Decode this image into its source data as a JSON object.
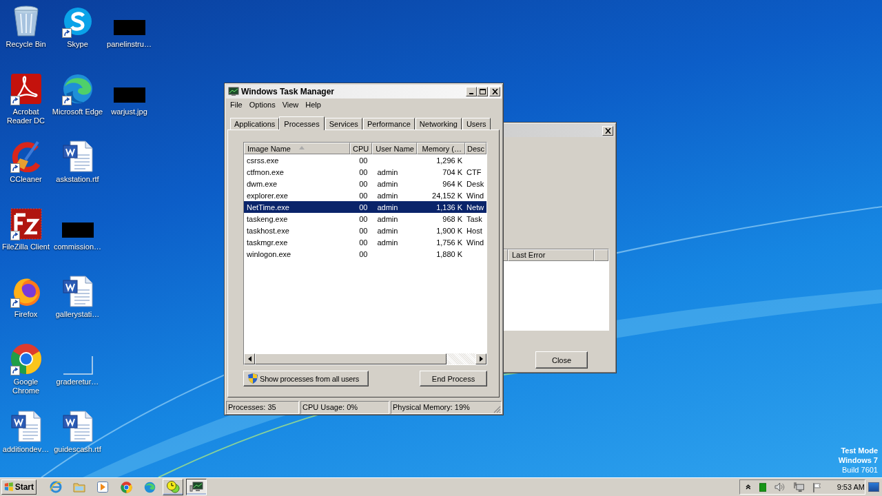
{
  "desktop_rows": [
    [
      {
        "label": "Recycle Bin",
        "kind": "recycle",
        "shortcut": false
      },
      {
        "label": "Skype",
        "kind": "skype",
        "shortcut": true
      },
      {
        "label": "panelinstru…",
        "kind": "redacted",
        "shortcut": false
      }
    ],
    [
      {
        "label": "Acrobat Reader DC",
        "kind": "acrobat",
        "shortcut": true
      },
      {
        "label": "Microsoft Edge",
        "kind": "edge",
        "shortcut": true
      },
      {
        "label": "warjust.jpg",
        "kind": "redacted",
        "shortcut": false
      }
    ],
    [
      {
        "label": "CCleaner",
        "kind": "ccleaner",
        "shortcut": true
      },
      {
        "label": "askstation.rtf",
        "kind": "word",
        "shortcut": false
      }
    ],
    [
      {
        "label": "FileZilla Client",
        "kind": "filezilla",
        "shortcut": true
      },
      {
        "label": "commission…",
        "kind": "redacted",
        "shortcut": false
      }
    ],
    [
      {
        "label": "Firefox",
        "kind": "firefox",
        "shortcut": true
      },
      {
        "label": "gallerystati…",
        "kind": "word",
        "shortcut": false
      }
    ],
    [
      {
        "label": "Google Chrome",
        "kind": "chrome",
        "shortcut": true
      },
      {
        "label": "graderetur…",
        "kind": "blank",
        "shortcut": false
      }
    ],
    [
      {
        "label": "additiondev…",
        "kind": "word",
        "shortcut": false
      },
      {
        "label": "guidescash.rtf",
        "kind": "word",
        "shortcut": false
      }
    ]
  ],
  "task_manager": {
    "title": "Windows Task Manager",
    "menu": [
      "File",
      "Options",
      "View",
      "Help"
    ],
    "tabs": [
      {
        "label": "Applications",
        "selected": false
      },
      {
        "label": "Processes",
        "selected": true
      },
      {
        "label": "Services",
        "selected": false
      },
      {
        "label": "Performance",
        "selected": false
      },
      {
        "label": "Networking",
        "selected": false
      },
      {
        "label": "Users",
        "selected": false
      }
    ],
    "columns": [
      "Image Name",
      "CPU",
      "User Name",
      "Memory (…",
      "Desc"
    ],
    "rows": [
      {
        "cells": [
          "csrss.exe",
          "00",
          "",
          "1,296 K",
          ""
        ],
        "selected": false
      },
      {
        "cells": [
          "ctfmon.exe",
          "00",
          "admin",
          "704 K",
          "CTF"
        ],
        "selected": false
      },
      {
        "cells": [
          "dwm.exe",
          "00",
          "admin",
          "964 K",
          "Desk"
        ],
        "selected": false
      },
      {
        "cells": [
          "explorer.exe",
          "00",
          "admin",
          "24,152 K",
          "Wind"
        ],
        "selected": false
      },
      {
        "cells": [
          "NetTime.exe",
          "00",
          "admin",
          "1,136 K",
          "Netw"
        ],
        "selected": true
      },
      {
        "cells": [
          "taskeng.exe",
          "00",
          "admin",
          "968 K",
          "Task"
        ],
        "selected": false
      },
      {
        "cells": [
          "taskhost.exe",
          "00",
          "admin",
          "1,900 K",
          "Host"
        ],
        "selected": false
      },
      {
        "cells": [
          "taskmgr.exe",
          "00",
          "admin",
          "1,756 K",
          "Wind"
        ],
        "selected": false
      },
      {
        "cells": [
          "winlogon.exe",
          "00",
          "",
          "1,880 K",
          ""
        ],
        "selected": false
      }
    ],
    "show_all_button": "Show processes from all users",
    "end_button": "End Process",
    "status": [
      "Processes: 35",
      "CPU Usage: 0%",
      "Physical Memory: 19%"
    ]
  },
  "background_window": {
    "column": "Last Error",
    "button": "Close"
  },
  "taskbar": {
    "start": "Start",
    "apps": [
      {
        "kind": "ie",
        "open": false,
        "selected": false
      },
      {
        "kind": "folder",
        "open": false,
        "selected": false
      },
      {
        "kind": "media",
        "open": false,
        "selected": false
      },
      {
        "kind": "chrome",
        "open": false,
        "selected": false
      },
      {
        "kind": "edge",
        "open": false,
        "selected": false
      },
      {
        "kind": "clock",
        "open": true,
        "selected": false
      },
      {
        "kind": "monitor",
        "open": true,
        "selected": true
      }
    ],
    "clock": "9:53 AM"
  },
  "os_notice": [
    "Test Mode",
    "Windows 7",
    "Build 7601"
  ]
}
